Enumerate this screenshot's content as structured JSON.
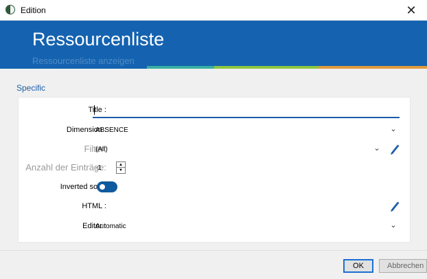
{
  "window": {
    "title": "Edition",
    "close_glyph": "✕",
    "icon": "app-logo-icon"
  },
  "banner": {
    "title": "Ressourcenliste",
    "subtitle": "Ressourcenliste anzeigen",
    "background": "#1563b0",
    "stripe_colors": [
      "#38b0a4",
      "#8cc63f",
      "#e09b3d"
    ]
  },
  "section": {
    "title": "Specific"
  },
  "form": {
    "title": {
      "label": "Title :",
      "value": ""
    },
    "dimension": {
      "label": "Dimension :",
      "value": "ABSENCE"
    },
    "filter": {
      "label": "Filter:",
      "value": "(All)"
    },
    "entries": {
      "label": "Anzahl der Einträge:",
      "value": "-1",
      "up": "▲",
      "down": "▼"
    },
    "inverted_sort": {
      "label": "Inverted sort :",
      "enabled": true
    },
    "html": {
      "label": "HTML :"
    },
    "editor": {
      "label": "Editor :",
      "value": "Automatic"
    }
  },
  "icons": {
    "chevron": "⌄",
    "pencil": "pencil-icon"
  },
  "buttons": {
    "ok": "OK",
    "cancel": "Abbrechen"
  },
  "colors": {
    "accent": "#1a5ea8",
    "toggle_on": "#0f5a9e"
  }
}
